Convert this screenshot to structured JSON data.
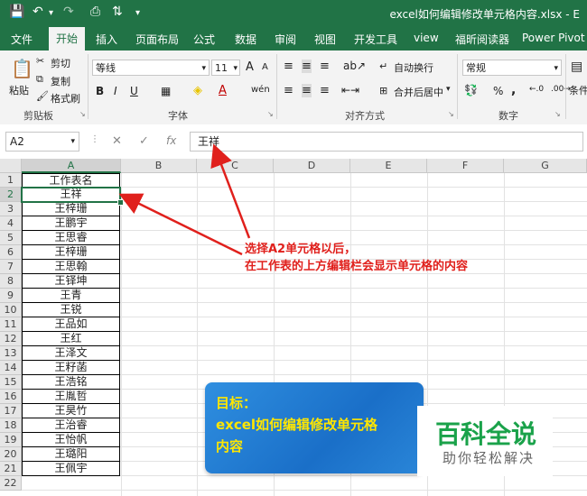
{
  "window": {
    "title": "excel如何编辑修改单元格内容.xlsx - E"
  },
  "qat": {
    "save_icon": "save-icon",
    "undo_icon": "undo-icon",
    "redo_icon": "redo-icon",
    "preview_icon": "print-preview-icon",
    "sort_icon": "sort-icon"
  },
  "tabs": [
    "文件",
    "开始",
    "插入",
    "页面布局",
    "公式",
    "数据",
    "审阅",
    "视图",
    "开发工具",
    "view",
    "福昕阅读器",
    "Power Pivot"
  ],
  "active_tab": "开始",
  "ribbon": {
    "clipboard": {
      "paste": "粘贴",
      "cut": "剪切",
      "copy": "复制",
      "format_painter": "格式刷",
      "label": "剪贴板"
    },
    "font": {
      "name": "等线",
      "size": "11",
      "grow": "A",
      "shrink": "A",
      "bold": "B",
      "italic": "I",
      "underline": "U",
      "fill_color": "◈",
      "font_color": "A",
      "phonetic": "wén",
      "label": "字体"
    },
    "alignment": {
      "wrap_text": "自动换行",
      "merge_center": "合并后居中",
      "label": "对齐方式"
    },
    "number": {
      "format": "常规",
      "percent": "%",
      "comma": ",",
      "label": "数字"
    },
    "styles": {
      "conditional": "条件"
    }
  },
  "formula_bar": {
    "name_box": "A2",
    "cancel": "✕",
    "enter": "✓",
    "fx": "fx",
    "content": "王祥"
  },
  "columns": [
    "A",
    "B",
    "C",
    "D",
    "E",
    "F",
    "G"
  ],
  "rows": [
    "1",
    "2",
    "3",
    "4",
    "5",
    "6",
    "7",
    "8",
    "9",
    "10",
    "11",
    "12",
    "13",
    "14",
    "15",
    "16",
    "17",
    "18",
    "19",
    "20",
    "21",
    "22"
  ],
  "column_a": [
    "工作表名",
    "王祥",
    "王梓珊",
    "王鹏宇",
    "王思睿",
    "王梓珊",
    "王思翰",
    "王铎坤",
    "王青",
    "王锐",
    "王品如",
    "王红",
    "王泽文",
    "王籽菡",
    "王浩铭",
    "王胤哲",
    "王昊竹",
    "王治睿",
    "王怡帆",
    "王璐阳",
    "王佩宇"
  ],
  "annotation": {
    "line1": "选择A2单元格以后，",
    "line2": "在工作表的上方编辑栏会显示单元格的内容",
    "color": "#e0201c"
  },
  "card": {
    "line1": "目标：",
    "line2": "excel如何编辑修改单元格",
    "line3": "内容"
  },
  "watermark": {
    "big": "百科全说",
    "small": "助你轻松解决"
  },
  "colors": {
    "excel_green": "#217346",
    "annotation_red": "#e0201c",
    "card_blue": "#1a6fc8",
    "card_text": "#ffe600",
    "watermark_green": "#1aa24a"
  }
}
